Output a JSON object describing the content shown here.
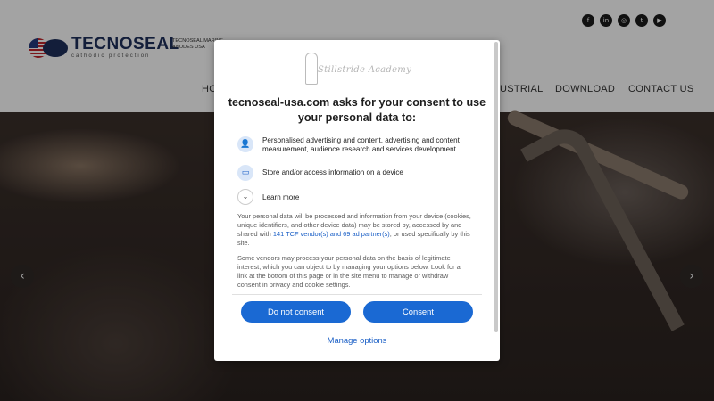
{
  "site": {
    "logo_name": "TECNOSEAL",
    "logo_sub": "cathodic protection",
    "tagline": "TECNOSEAL MARINE ANODES USA",
    "social_icons": [
      "f",
      "in",
      "◎",
      "t",
      "▶"
    ],
    "nav": {
      "home_partial": "HO",
      "industrial_partial": "USTRIAL",
      "download": "DOWNLOAD",
      "contact": "CONTACT US"
    },
    "slider": {
      "prev_arrow": "‹",
      "next_arrow": "›"
    }
  },
  "consent": {
    "publisher_logo_text": "Stillstride Academy",
    "heading": "tecnoseal-usa.com asks for your consent to use your personal data to:",
    "purposes": [
      {
        "icon": "person-icon",
        "glyph": "👤",
        "text": "Personalised advertising and content, advertising and content measurement, audience research and services development"
      },
      {
        "icon": "device-icon",
        "glyph": "▭",
        "text": "Store and/or access information on a device"
      }
    ],
    "learn_more": "Learn more",
    "learn_more_glyph": "⌄",
    "body_1_pre": "Your personal data will be processed and information from your device (cookies, unique identifiers, and other device data) may be stored by, accessed by and shared with ",
    "body_1_link": "141 TCF vendor(s) and 69 ad partner(s)",
    "body_1_post": ", or used specifically by this site.",
    "body_2": "Some vendors may process your personal data on the basis of legitimate interest, which you can object to by managing your options below. Look for a link at the bottom of this page or in the site menu to manage or withdraw consent in privacy and cookie settings.",
    "do_not_consent": "Do not consent",
    "consent": "Consent",
    "manage_options": "Manage options"
  },
  "colors": {
    "primary_button": "#1a69d3",
    "link": "#1a5fc6",
    "overlay": "rgba(0,0,0,0.36)"
  }
}
